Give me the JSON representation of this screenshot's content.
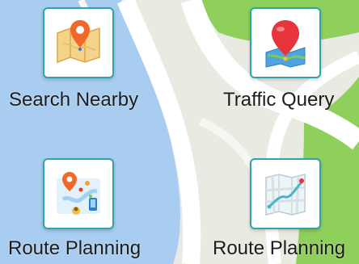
{
  "menu": {
    "items": [
      {
        "label": "Search Nearby",
        "icon": "map-pin-icon"
      },
      {
        "label": "Traffic Query",
        "icon": "balloon-pin-icon"
      },
      {
        "label": "Route Planning",
        "icon": "route-network-icon"
      },
      {
        "label": "Route Planning",
        "icon": "city-map-icon"
      }
    ]
  },
  "colors": {
    "tile_border": "#2ea6a8",
    "water": "#a8cdf0",
    "park": "#8fcf5c",
    "road": "#ffffff",
    "land": "#e9ebe3"
  }
}
